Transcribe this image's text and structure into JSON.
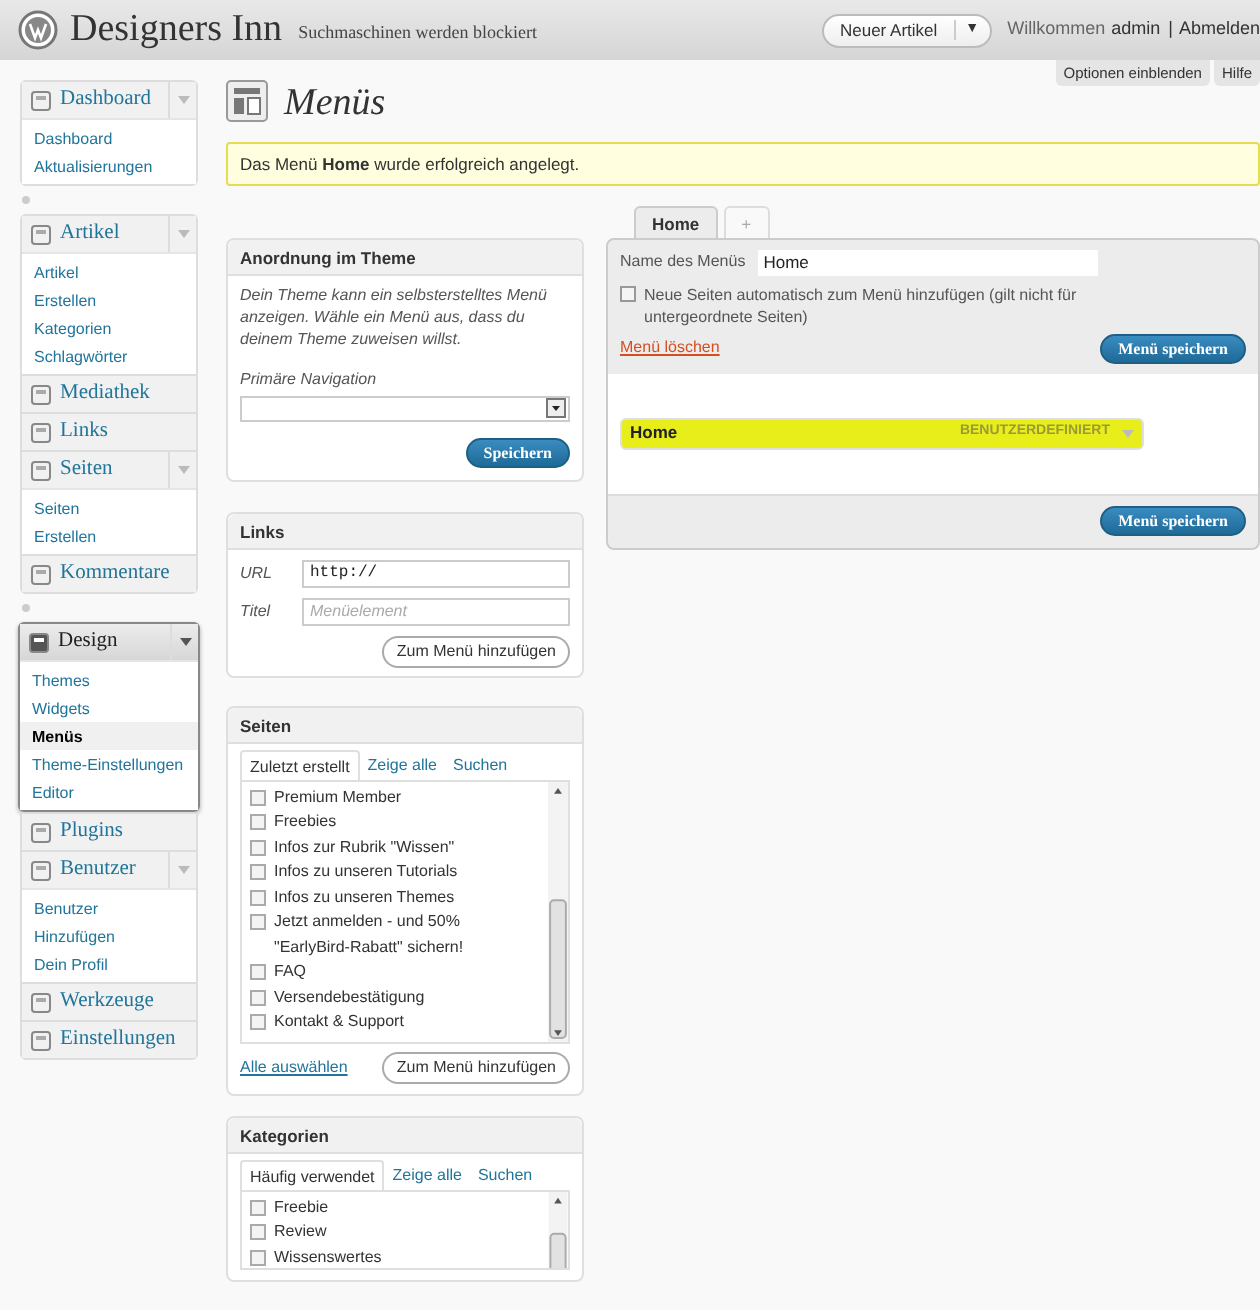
{
  "header": {
    "site_title": "Designers Inn",
    "site_note": "Suchmaschinen werden blockiert",
    "new_button": "Neuer Artikel",
    "new_button_caret": "▼",
    "greeting": "Willkommen",
    "user": "admin",
    "separator": "|",
    "logout": "Abmelden"
  },
  "screen_options": [
    {
      "label": "Optionen einblenden"
    },
    {
      "label": "Hilfe"
    }
  ],
  "sidebar": {
    "groups": [
      {
        "menus": [
          {
            "label": "Dashboard",
            "current": false,
            "children": [
              {
                "label": "Dashboard",
                "selected": false
              },
              {
                "label": "Aktualisierungen",
                "selected": false
              }
            ]
          }
        ]
      },
      {
        "menus": [
          {
            "label": "Artikel",
            "current": false,
            "children": [
              {
                "label": "Artikel",
                "selected": false
              },
              {
                "label": "Erstellen",
                "selected": false
              },
              {
                "label": "Kategorien",
                "selected": false
              },
              {
                "label": "Schlagwörter",
                "selected": false
              }
            ]
          },
          {
            "label": "Mediathek",
            "current": false
          },
          {
            "label": "Links",
            "current": false
          },
          {
            "label": "Seiten",
            "current": false,
            "children": [
              {
                "label": "Seiten",
                "selected": false
              },
              {
                "label": "Erstellen",
                "selected": false
              }
            ]
          },
          {
            "label": "Kommentare",
            "current": false
          }
        ]
      },
      {
        "menus": [
          {
            "label": "Design",
            "current": true,
            "children": [
              {
                "label": "Themes",
                "selected": false
              },
              {
                "label": "Widgets",
                "selected": false
              },
              {
                "label": "Menüs",
                "selected": true
              },
              {
                "label": "Theme-Einstellungen",
                "selected": false
              },
              {
                "label": "Editor",
                "selected": false
              }
            ]
          },
          {
            "label": "Plugins",
            "current": false
          },
          {
            "label": "Benutzer",
            "current": false,
            "children": [
              {
                "label": "Benutzer",
                "selected": false
              },
              {
                "label": "Hinzufügen",
                "selected": false
              },
              {
                "label": "Dein Profil",
                "selected": false
              }
            ]
          },
          {
            "label": "Werkzeuge",
            "current": false
          },
          {
            "label": "Einstellungen",
            "current": false
          }
        ]
      }
    ]
  },
  "page": {
    "title": "Menüs",
    "notice": "Das Menü **Home** wurde erfolgreich angelegt."
  },
  "theme_locations": {
    "title": "Anordnung im Theme",
    "description": "Dein Theme kann ein selbsterstelltes Menü anzeigen. Wähle ein Menü aus, dass du deinem Theme zuweisen willst.",
    "select_label": "Primäre Navigation",
    "button": "Speichern"
  },
  "links_box": {
    "title": "Links",
    "url_label": "URL",
    "url_value": "http://",
    "title_label": "Titel",
    "title_placeholder": "Menüelement",
    "button": "Zum Menü hinzufügen"
  },
  "pages_box": {
    "title": "Seiten",
    "tabs": [
      {
        "label": "Zuletzt erstellt",
        "selected": true
      },
      {
        "label": "Zeige alle",
        "selected": false
      },
      {
        "label": "Suchen",
        "selected": false
      }
    ],
    "items": [
      {
        "label": "Premium Member",
        "checked": false
      },
      {
        "label": "Freebies",
        "checked": false
      },
      {
        "label": "Infos zur Rubrik \"Wissen\"",
        "checked": false
      },
      {
        "label": "Infos zu unseren Tutorials",
        "checked": false
      },
      {
        "label": "Infos zu unseren Themes",
        "checked": false
      },
      {
        "label": "Jetzt anmelden - und 50% \"EarlyBird-Rabatt\" sichern!",
        "checked": false
      },
      {
        "label": "FAQ",
        "checked": false
      },
      {
        "label": "Versendebestätigung",
        "checked": false
      },
      {
        "label": "Kontakt & Support",
        "checked": false
      }
    ],
    "select_all": "Alle auswählen",
    "button": "Zum Menü hinzufügen"
  },
  "categories_box": {
    "title": "Kategorien",
    "tabs": [
      {
        "label": "Häufig verwendet",
        "selected": true
      },
      {
        "label": "Zeige alle",
        "selected": false
      },
      {
        "label": "Suchen",
        "selected": false
      }
    ],
    "items": [
      {
        "label": "Freebie",
        "checked": false
      },
      {
        "label": "Review",
        "checked": false
      },
      {
        "label": "Wissenswertes",
        "checked": false
      }
    ]
  },
  "menu_editor": {
    "tabs": [
      {
        "label": "Home",
        "selected": true
      },
      {
        "label": "+",
        "selected": false
      }
    ],
    "name_label": "Name des Menüs",
    "name_value": "Home",
    "auto_add_label": "Neue Seiten automatisch zum Menü hinzufügen (gilt nicht für untergeordnete Seiten)",
    "auto_add": false,
    "delete_link": "Menü löschen",
    "save_button": "Menü speichern",
    "items": [
      {
        "label": "Home",
        "type": "BENUTZERDEFINIERT",
        "highlighted": true
      }
    ],
    "save_button_bottom": "Menü speichern"
  }
}
